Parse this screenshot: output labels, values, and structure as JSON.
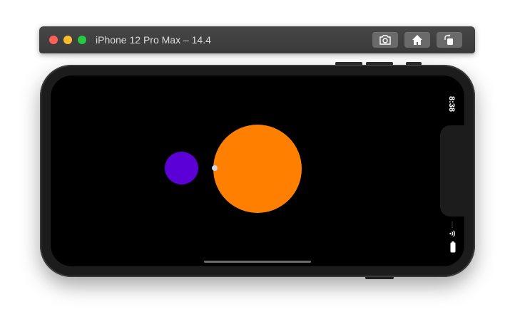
{
  "window": {
    "title": "iPhone 12 Pro Max – 14.4",
    "traffic_light_colors": {
      "close": "#ff5f57",
      "minimize": "#febc2e",
      "zoom": "#28c840"
    },
    "toolbar_icons": [
      "screenshot-icon",
      "home-icon",
      "rotate-icon"
    ]
  },
  "status_bar": {
    "time": "8:38"
  },
  "scene": {
    "background_color": "#000000",
    "circles": [
      {
        "name": "purple-circle",
        "color": "#5b00d6"
      },
      {
        "name": "orange-circle",
        "color": "#ff8000"
      },
      {
        "name": "small-dot",
        "color": "#cfd6e8"
      }
    ]
  }
}
